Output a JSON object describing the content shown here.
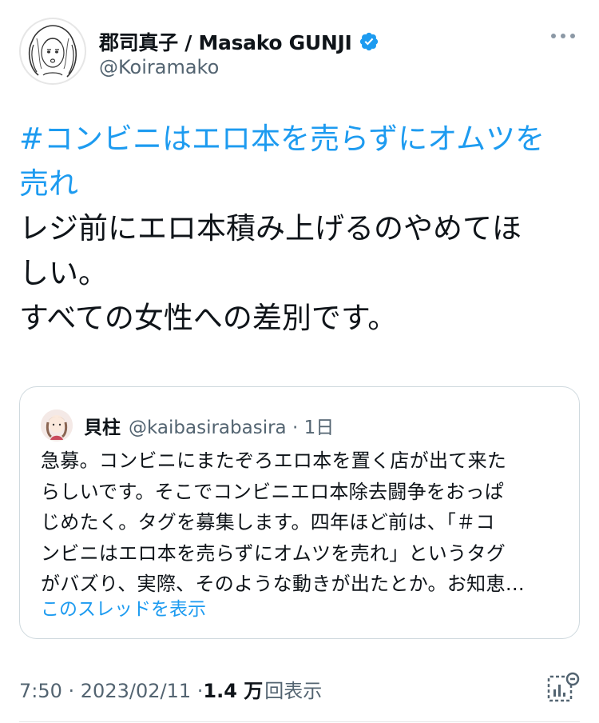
{
  "author": {
    "display_name": "郡司真子 / Masako GUNJI",
    "handle": "@Koiramako"
  },
  "tweet": {
    "hashtag_line1": "#コンビニはエロ本を売らずにオムツを",
    "hashtag_line2": "売れ",
    "body_line1": "レジ前にエロ本積み上げるのやめてほ",
    "body_line2": "しい。",
    "body_line3": "すべての女性への差別です。"
  },
  "quoted": {
    "name": "貝柱",
    "handle_time": "@kaibasirabasira · 1日",
    "lines": [
      "急募。コンビニにまたぞろエロ本を置く店が出て来た",
      "らしいです。そこでコンビニエロ本除去闘争をおっぱ",
      "じめたく。タグを募集します。四年ほど前は、「＃コ",
      "ンビニはエロ本を売らずにオムツを売れ」というタグ",
      "がバズり、実際、そのような動きが出たとか。お知恵…"
    ],
    "show_thread": "このスレッドを表示"
  },
  "meta": {
    "timestamp": "7:50 · 2023/02/11 · ",
    "views_count": "1.4 万",
    "views_label": "回表示"
  },
  "icons": {
    "verified": "verified-badge-icon",
    "more": "more-icon",
    "analytics": "analytics-icon"
  },
  "colors": {
    "accent": "#1d9bf0",
    "secondary_text": "#536471",
    "border": "#cfd9de"
  }
}
